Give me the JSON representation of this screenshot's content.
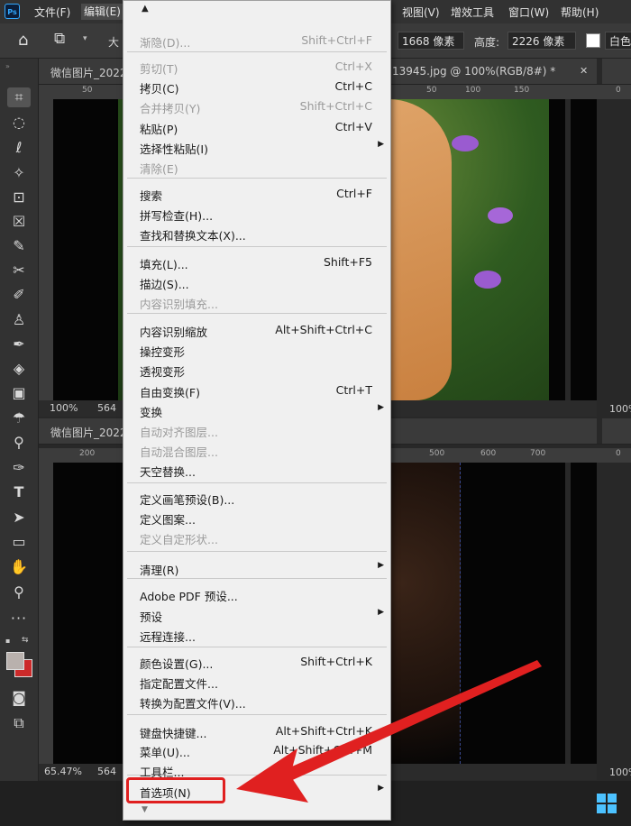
{
  "menubar": {
    "logo": "Ps",
    "items_left": [
      "文件(F)",
      "编辑(E)"
    ],
    "items_right": [
      "视图(V)",
      "增效工具",
      "窗口(W)",
      "帮助(H)"
    ]
  },
  "options": {
    "partial_label": "大",
    "width_value": "1668 像素",
    "height_label": "高度:",
    "height_value": "2226 像素",
    "partial_color": "白色"
  },
  "documents": {
    "top": {
      "tab_left": "微信图片_2022",
      "tab_right": "13945.jpg @ 100%(RGB/8#) *",
      "ruler_ticks": [
        "50",
        "50",
        "100",
        "150",
        "0"
      ],
      "status_zoom": "100%",
      "status_size": "564",
      "right_zoom": "100%"
    },
    "bottom": {
      "tab_left": "微信图片_2022",
      "ruler_ticks": [
        "200",
        "500",
        "600",
        "700",
        "0"
      ],
      "status_zoom": "65.47%",
      "status_size": "564",
      "right_zoom": "100%"
    }
  },
  "menu": {
    "items": [
      {
        "label": "渐隐(D)...",
        "shortcut": "Shift+Ctrl+F",
        "disabled": true,
        "submenu": false
      },
      {
        "label": "剪切(T)",
        "shortcut": "Ctrl+X",
        "disabled": true,
        "submenu": false
      },
      {
        "label": "拷贝(C)",
        "shortcut": "Ctrl+C",
        "disabled": false,
        "submenu": false
      },
      {
        "label": "合并拷贝(Y)",
        "shortcut": "Shift+Ctrl+C",
        "disabled": true,
        "submenu": false
      },
      {
        "label": "粘贴(P)",
        "shortcut": "Ctrl+V",
        "disabled": false,
        "submenu": false
      },
      {
        "label": "选择性粘贴(I)",
        "shortcut": "",
        "disabled": false,
        "submenu": true
      },
      {
        "label": "清除(E)",
        "shortcut": "",
        "disabled": true,
        "submenu": false
      },
      {
        "label": "搜索",
        "shortcut": "Ctrl+F",
        "disabled": false,
        "submenu": false
      },
      {
        "label": "拼写检查(H)...",
        "shortcut": "",
        "disabled": false,
        "submenu": false
      },
      {
        "label": "查找和替换文本(X)...",
        "shortcut": "",
        "disabled": false,
        "submenu": false
      },
      {
        "label": "填充(L)...",
        "shortcut": "Shift+F5",
        "disabled": false,
        "submenu": false
      },
      {
        "label": "描边(S)...",
        "shortcut": "",
        "disabled": false,
        "submenu": false
      },
      {
        "label": "内容识别填充...",
        "shortcut": "",
        "disabled": true,
        "submenu": false
      },
      {
        "label": "内容识别缩放",
        "shortcut": "Alt+Shift+Ctrl+C",
        "disabled": false,
        "submenu": false
      },
      {
        "label": "操控变形",
        "shortcut": "",
        "disabled": false,
        "submenu": false
      },
      {
        "label": "透视变形",
        "shortcut": "",
        "disabled": false,
        "submenu": false
      },
      {
        "label": "自由变换(F)",
        "shortcut": "Ctrl+T",
        "disabled": false,
        "submenu": false
      },
      {
        "label": "变换",
        "shortcut": "",
        "disabled": false,
        "submenu": true
      },
      {
        "label": "自动对齐图层...",
        "shortcut": "",
        "disabled": true,
        "submenu": false
      },
      {
        "label": "自动混合图层...",
        "shortcut": "",
        "disabled": true,
        "submenu": false
      },
      {
        "label": "天空替换...",
        "shortcut": "",
        "disabled": false,
        "submenu": false
      },
      {
        "label": "定义画笔预设(B)...",
        "shortcut": "",
        "disabled": false,
        "submenu": false
      },
      {
        "label": "定义图案...",
        "shortcut": "",
        "disabled": false,
        "submenu": false
      },
      {
        "label": "定义自定形状...",
        "shortcut": "",
        "disabled": true,
        "submenu": false
      },
      {
        "label": "清理(R)",
        "shortcut": "",
        "disabled": false,
        "submenu": true
      },
      {
        "label": "Adobe PDF 预设...",
        "shortcut": "",
        "disabled": false,
        "submenu": false
      },
      {
        "label": "预设",
        "shortcut": "",
        "disabled": false,
        "submenu": true
      },
      {
        "label": "远程连接...",
        "shortcut": "",
        "disabled": false,
        "submenu": false
      },
      {
        "label": "颜色设置(G)...",
        "shortcut": "Shift+Ctrl+K",
        "disabled": false,
        "submenu": false
      },
      {
        "label": "指定配置文件...",
        "shortcut": "",
        "disabled": false,
        "submenu": false
      },
      {
        "label": "转换为配置文件(V)...",
        "shortcut": "",
        "disabled": false,
        "submenu": false
      },
      {
        "label": "键盘快捷键...",
        "shortcut": "Alt+Shift+Ctrl+K",
        "disabled": false,
        "submenu": false
      },
      {
        "label": "菜单(U)...",
        "shortcut": "Alt+Shift+Ctrl+M",
        "disabled": false,
        "submenu": false
      },
      {
        "label": "工具栏...",
        "shortcut": "",
        "disabled": false,
        "submenu": false
      },
      {
        "label": "首选项(N)",
        "shortcut": "",
        "disabled": false,
        "submenu": true
      }
    ]
  },
  "colors": {
    "highlight": "#e02020",
    "accent": "#31a8ff"
  }
}
